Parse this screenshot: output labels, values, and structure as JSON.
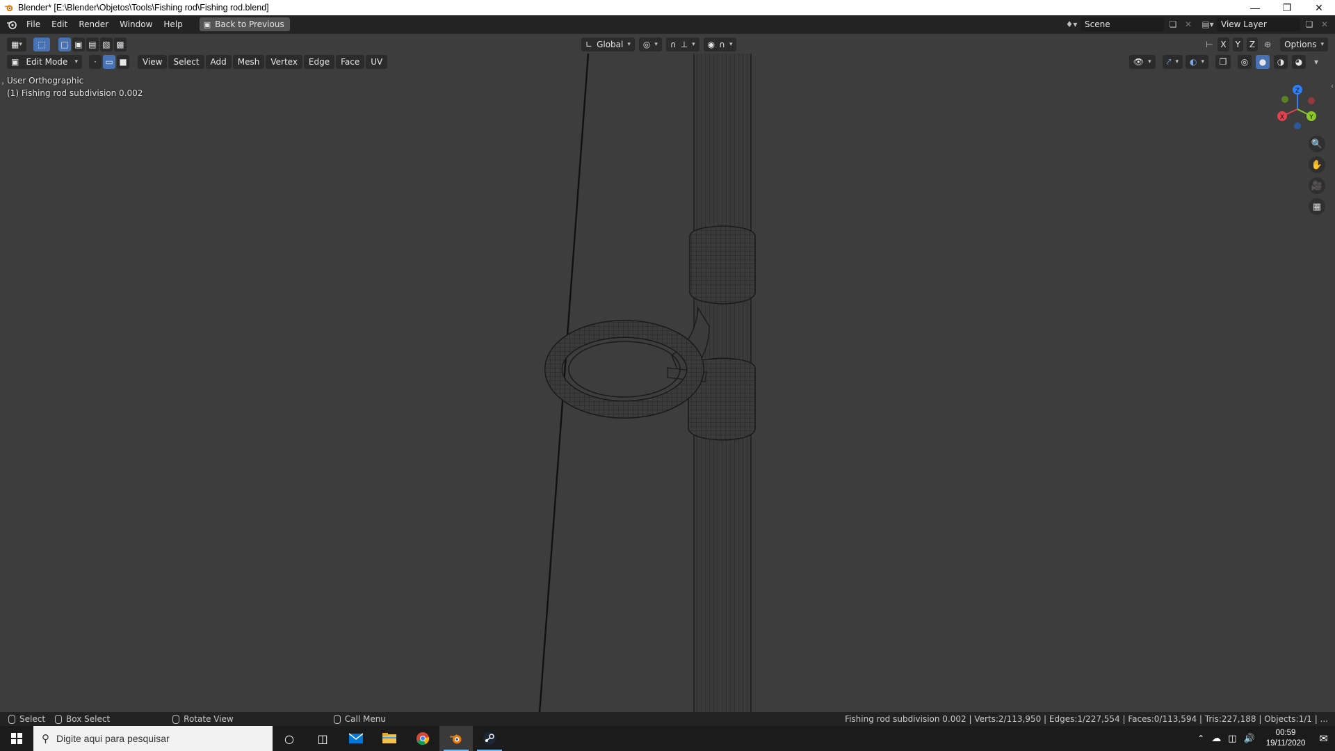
{
  "window": {
    "title": "Blender* [E:\\Blender\\Objetos\\Tools\\Fishing rod\\Fishing rod.blend]"
  },
  "topbar": {
    "menus": [
      "File",
      "Edit",
      "Render",
      "Window",
      "Help"
    ],
    "back_button": "Back to Previous",
    "scene": "Scene",
    "view_layer": "View Layer"
  },
  "viewport_header": {
    "transform_orientation": "Global",
    "options": "Options",
    "axes": [
      "X",
      "Y",
      "Z"
    ],
    "mode": "Edit Mode",
    "menus": [
      "View",
      "Select",
      "Add",
      "Mesh",
      "Vertex",
      "Edge",
      "Face",
      "UV"
    ]
  },
  "viewport": {
    "view_name": "User Orthographic",
    "object_name": "(1) Fishing rod subdivision 0.002",
    "gizmo_labels": {
      "x": "X",
      "y": "Y",
      "z": "Z"
    }
  },
  "statusbar": {
    "select": "Select",
    "box_select": "Box Select",
    "rotate_view": "Rotate View",
    "call_menu": "Call Menu",
    "stats": "Fishing rod subdivision 0.002 | Verts:2/113,950 | Edges:1/227,554 | Faces:0/113,594 | Tris:227,188 | Objects:1/1 | ..."
  },
  "taskbar": {
    "search_placeholder": "Digite aqui para pesquisar",
    "time": "00:59",
    "date": "19/11/2020"
  },
  "colors": {
    "accent": "#4772b3",
    "axis_x": "#e2424e",
    "axis_y": "#8ac926",
    "axis_z": "#2d7ff9"
  }
}
